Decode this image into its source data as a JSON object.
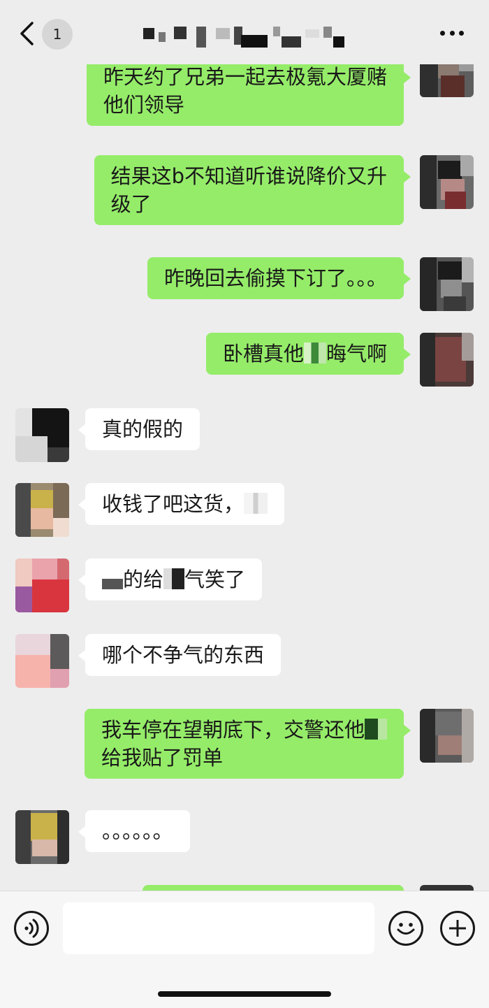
{
  "header": {
    "unread_count": "1"
  },
  "messages": [
    {
      "sender": "me",
      "lines": [
        "昨天约了兄弟一起去极氪大厦赌",
        "他们领导"
      ]
    },
    {
      "sender": "me",
      "lines": [
        "结果这b不知道听谁说降价又升",
        "级了"
      ]
    },
    {
      "sender": "me",
      "lines": [
        "昨晚回去偷摸下订了。。。"
      ]
    },
    {
      "sender": "me",
      "lines": [
        "卧槽真他",
        "晦气啊"
      ]
    },
    {
      "sender": "them",
      "lines": [
        "真的假的"
      ]
    },
    {
      "sender": "them",
      "lines": [
        "收钱了吧这货，"
      ]
    },
    {
      "sender": "them",
      "lines": [
        "的给",
        "气笑了"
      ]
    },
    {
      "sender": "them",
      "lines": [
        "哪个不争气的东西"
      ]
    },
    {
      "sender": "me",
      "lines": [
        "我车停在望朝底下，交警还他",
        "给我贴了罚单"
      ]
    },
    {
      "sender": "them",
      "lines": [
        "。。。。。。"
      ]
    }
  ],
  "input_bar": {
    "placeholder": ""
  },
  "icons": {
    "back": "chevron-left-icon",
    "more": "more-dots-icon",
    "voice": "voice-icon",
    "emoji": "emoji-smile-icon",
    "plus": "plus-icon"
  },
  "colors": {
    "background": "#ededed",
    "my_bubble": "#95ec69",
    "their_bubble": "#ffffff"
  }
}
